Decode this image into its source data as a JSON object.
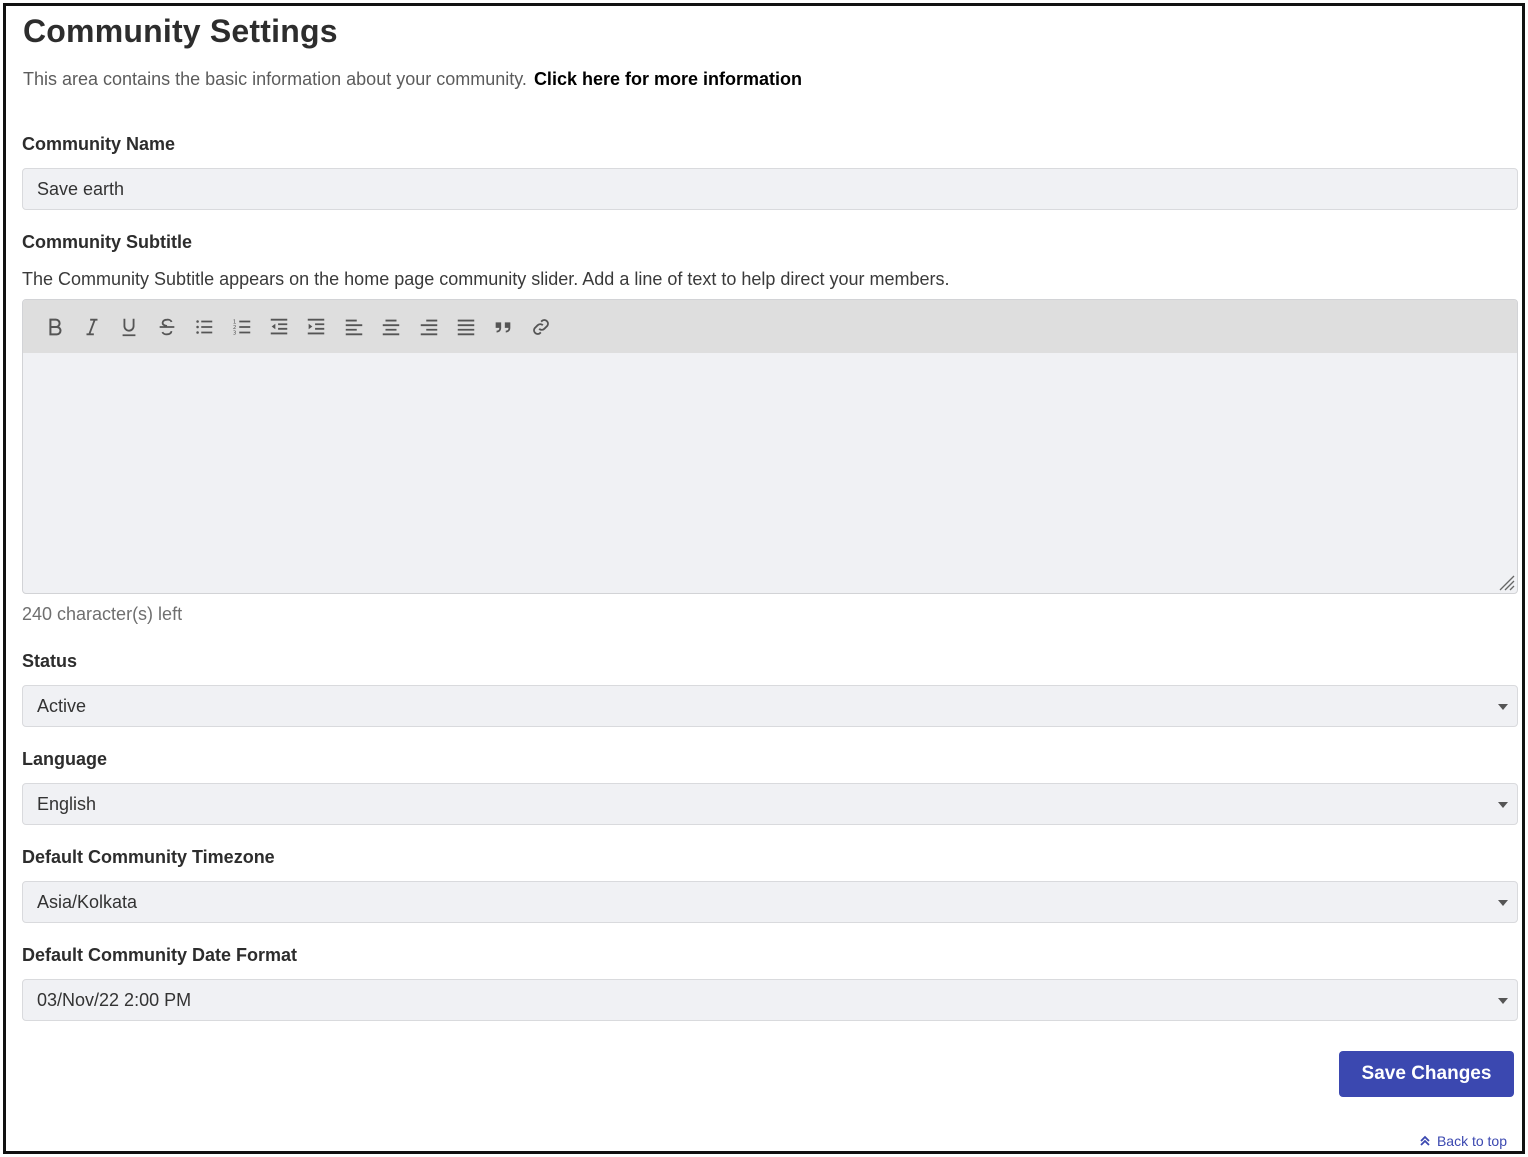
{
  "page": {
    "title": "Community Settings",
    "intro_text": "This area contains the basic information about your community.",
    "intro_link": "Click here for more information"
  },
  "form": {
    "community_name": {
      "label": "Community Name",
      "value": "Save earth"
    },
    "community_subtitle": {
      "label": "Community Subtitle",
      "help": "The Community Subtitle appears on the home page community slider. Add a line of text to help direct your members.",
      "value": "",
      "chars_left": "240 character(s) left",
      "toolbar": [
        "bold-icon",
        "italic-icon",
        "underline-icon",
        "strikethrough-icon",
        "bullet-list-icon",
        "numbered-list-icon",
        "outdent-icon",
        "indent-icon",
        "align-left-icon",
        "align-center-icon",
        "align-right-icon",
        "align-justify-icon",
        "quote-icon",
        "link-icon"
      ]
    },
    "status": {
      "label": "Status",
      "value": "Active"
    },
    "language": {
      "label": "Language",
      "value": "English"
    },
    "timezone": {
      "label": "Default Community Timezone",
      "value": "Asia/Kolkata"
    },
    "date_format": {
      "label": "Default Community Date Format",
      "value": "03/Nov/22 2:00 PM"
    }
  },
  "actions": {
    "save_label": "Save Changes",
    "back_to_top": "Back to top"
  },
  "colors": {
    "primary": "#3b48b0",
    "field_bg": "#f0f1f4",
    "toolbar_bg": "#dedede"
  }
}
